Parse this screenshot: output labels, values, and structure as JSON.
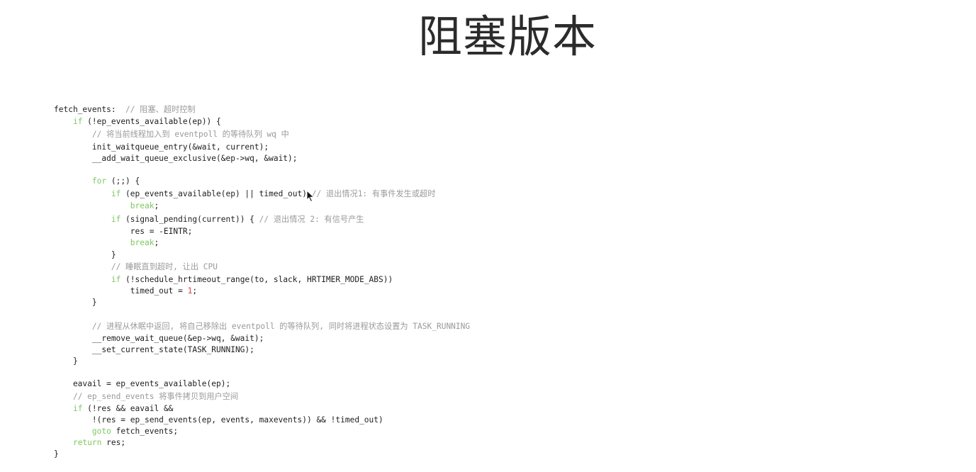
{
  "slide": {
    "title": "阻塞版本"
  },
  "code": [
    {
      "tokens": [
        {
          "t": "fetch_events:  ",
          "c": ""
        },
        {
          "t": "// 阻塞、超时控制",
          "c": "cm"
        }
      ]
    },
    {
      "tokens": [
        {
          "t": "    ",
          "c": ""
        },
        {
          "t": "if",
          "c": "kw"
        },
        {
          "t": " (!ep_events_available(ep)) {",
          "c": ""
        }
      ]
    },
    {
      "tokens": [
        {
          "t": "        ",
          "c": ""
        },
        {
          "t": "// 将当前线程加入到 eventpoll 的等待队列 wq 中",
          "c": "cm"
        }
      ]
    },
    {
      "tokens": [
        {
          "t": "        init_waitqueue_entry(&wait, current);",
          "c": ""
        }
      ]
    },
    {
      "tokens": [
        {
          "t": "        __add_wait_queue_exclusive(&ep->wq, &wait);",
          "c": ""
        }
      ]
    },
    {
      "tokens": [
        {
          "t": "        ",
          "c": ""
        },
        {
          "t": "for",
          "c": "kw"
        },
        {
          "t": " (;;) {",
          "c": ""
        }
      ]
    },
    {
      "tokens": [
        {
          "t": "            ",
          "c": ""
        },
        {
          "t": "if",
          "c": "kw"
        },
        {
          "t": " (ep_events_available(ep) || timed_out) ",
          "c": ""
        },
        {
          "t": "// 退出情况1: 有事件发生或超时",
          "c": "cm"
        }
      ]
    },
    {
      "tokens": [
        {
          "t": "                ",
          "c": ""
        },
        {
          "t": "break",
          "c": "kw"
        },
        {
          "t": ";",
          "c": ""
        }
      ]
    },
    {
      "tokens": [
        {
          "t": "            ",
          "c": ""
        },
        {
          "t": "if",
          "c": "kw"
        },
        {
          "t": " (signal_pending(current)) { ",
          "c": ""
        },
        {
          "t": "// 退出情况 2: 有信号产生",
          "c": "cm"
        }
      ]
    },
    {
      "tokens": [
        {
          "t": "                res = -EINTR;",
          "c": ""
        }
      ]
    },
    {
      "tokens": [
        {
          "t": "                ",
          "c": ""
        },
        {
          "t": "break",
          "c": "kw"
        },
        {
          "t": ";",
          "c": ""
        }
      ]
    },
    {
      "tokens": [
        {
          "t": "            }",
          "c": ""
        }
      ]
    },
    {
      "tokens": [
        {
          "t": "            ",
          "c": ""
        },
        {
          "t": "// 睡眠直到超时, 让出 CPU",
          "c": "cm"
        }
      ]
    },
    {
      "tokens": [
        {
          "t": "            ",
          "c": ""
        },
        {
          "t": "if",
          "c": "kw"
        },
        {
          "t": " (!schedule_hrtimeout_range(to, slack, HRTIMER_MODE_ABS))",
          "c": ""
        }
      ]
    },
    {
      "tokens": [
        {
          "t": "                timed_out = ",
          "c": ""
        },
        {
          "t": "1",
          "c": "num"
        },
        {
          "t": ";",
          "c": ""
        }
      ]
    },
    {
      "tokens": [
        {
          "t": "        }",
          "c": ""
        }
      ]
    },
    {
      "tokens": [
        {
          "t": "        ",
          "c": ""
        },
        {
          "t": "// 进程从休眠中返回, 将自己移除出 eventpoll 的等待队列, 同时将进程状态设置为 TASK_RUNNING",
          "c": "cm"
        }
      ]
    },
    {
      "tokens": [
        {
          "t": "        __remove_wait_queue(&ep->wq, &wait);",
          "c": ""
        }
      ]
    },
    {
      "tokens": [
        {
          "t": "        __set_current_state(TASK_RUNNING);",
          "c": ""
        }
      ]
    },
    {
      "tokens": [
        {
          "t": "    }",
          "c": ""
        }
      ]
    },
    {
      "tokens": [
        {
          "t": "    eavail = ep_events_available(ep);",
          "c": ""
        }
      ]
    },
    {
      "tokens": [
        {
          "t": "    ",
          "c": ""
        },
        {
          "t": "// ep_send_events 将事件拷贝到用户空间",
          "c": "cm"
        }
      ]
    },
    {
      "tokens": [
        {
          "t": "    ",
          "c": ""
        },
        {
          "t": "if",
          "c": "kw"
        },
        {
          "t": " (!res && eavail &&",
          "c": ""
        }
      ]
    },
    {
      "tokens": [
        {
          "t": "        !(res = ep_send_events(ep, events, maxevents)) && !timed_out)",
          "c": ""
        }
      ]
    },
    {
      "tokens": [
        {
          "t": "        ",
          "c": ""
        },
        {
          "t": "goto",
          "c": "kw"
        },
        {
          "t": " fetch_events;",
          "c": ""
        }
      ]
    },
    {
      "tokens": [
        {
          "t": "    ",
          "c": ""
        },
        {
          "t": "return",
          "c": "kw"
        },
        {
          "t": " res;",
          "c": ""
        }
      ]
    },
    {
      "tokens": [
        {
          "t": "}",
          "c": ""
        }
      ]
    }
  ],
  "colors": {
    "keyword": "#7dc95e",
    "comment": "#9a9a9a",
    "number": "#e2433b",
    "text": "#1e1e1e"
  },
  "icons": {
    "cursor": "mouse-pointer-icon"
  }
}
